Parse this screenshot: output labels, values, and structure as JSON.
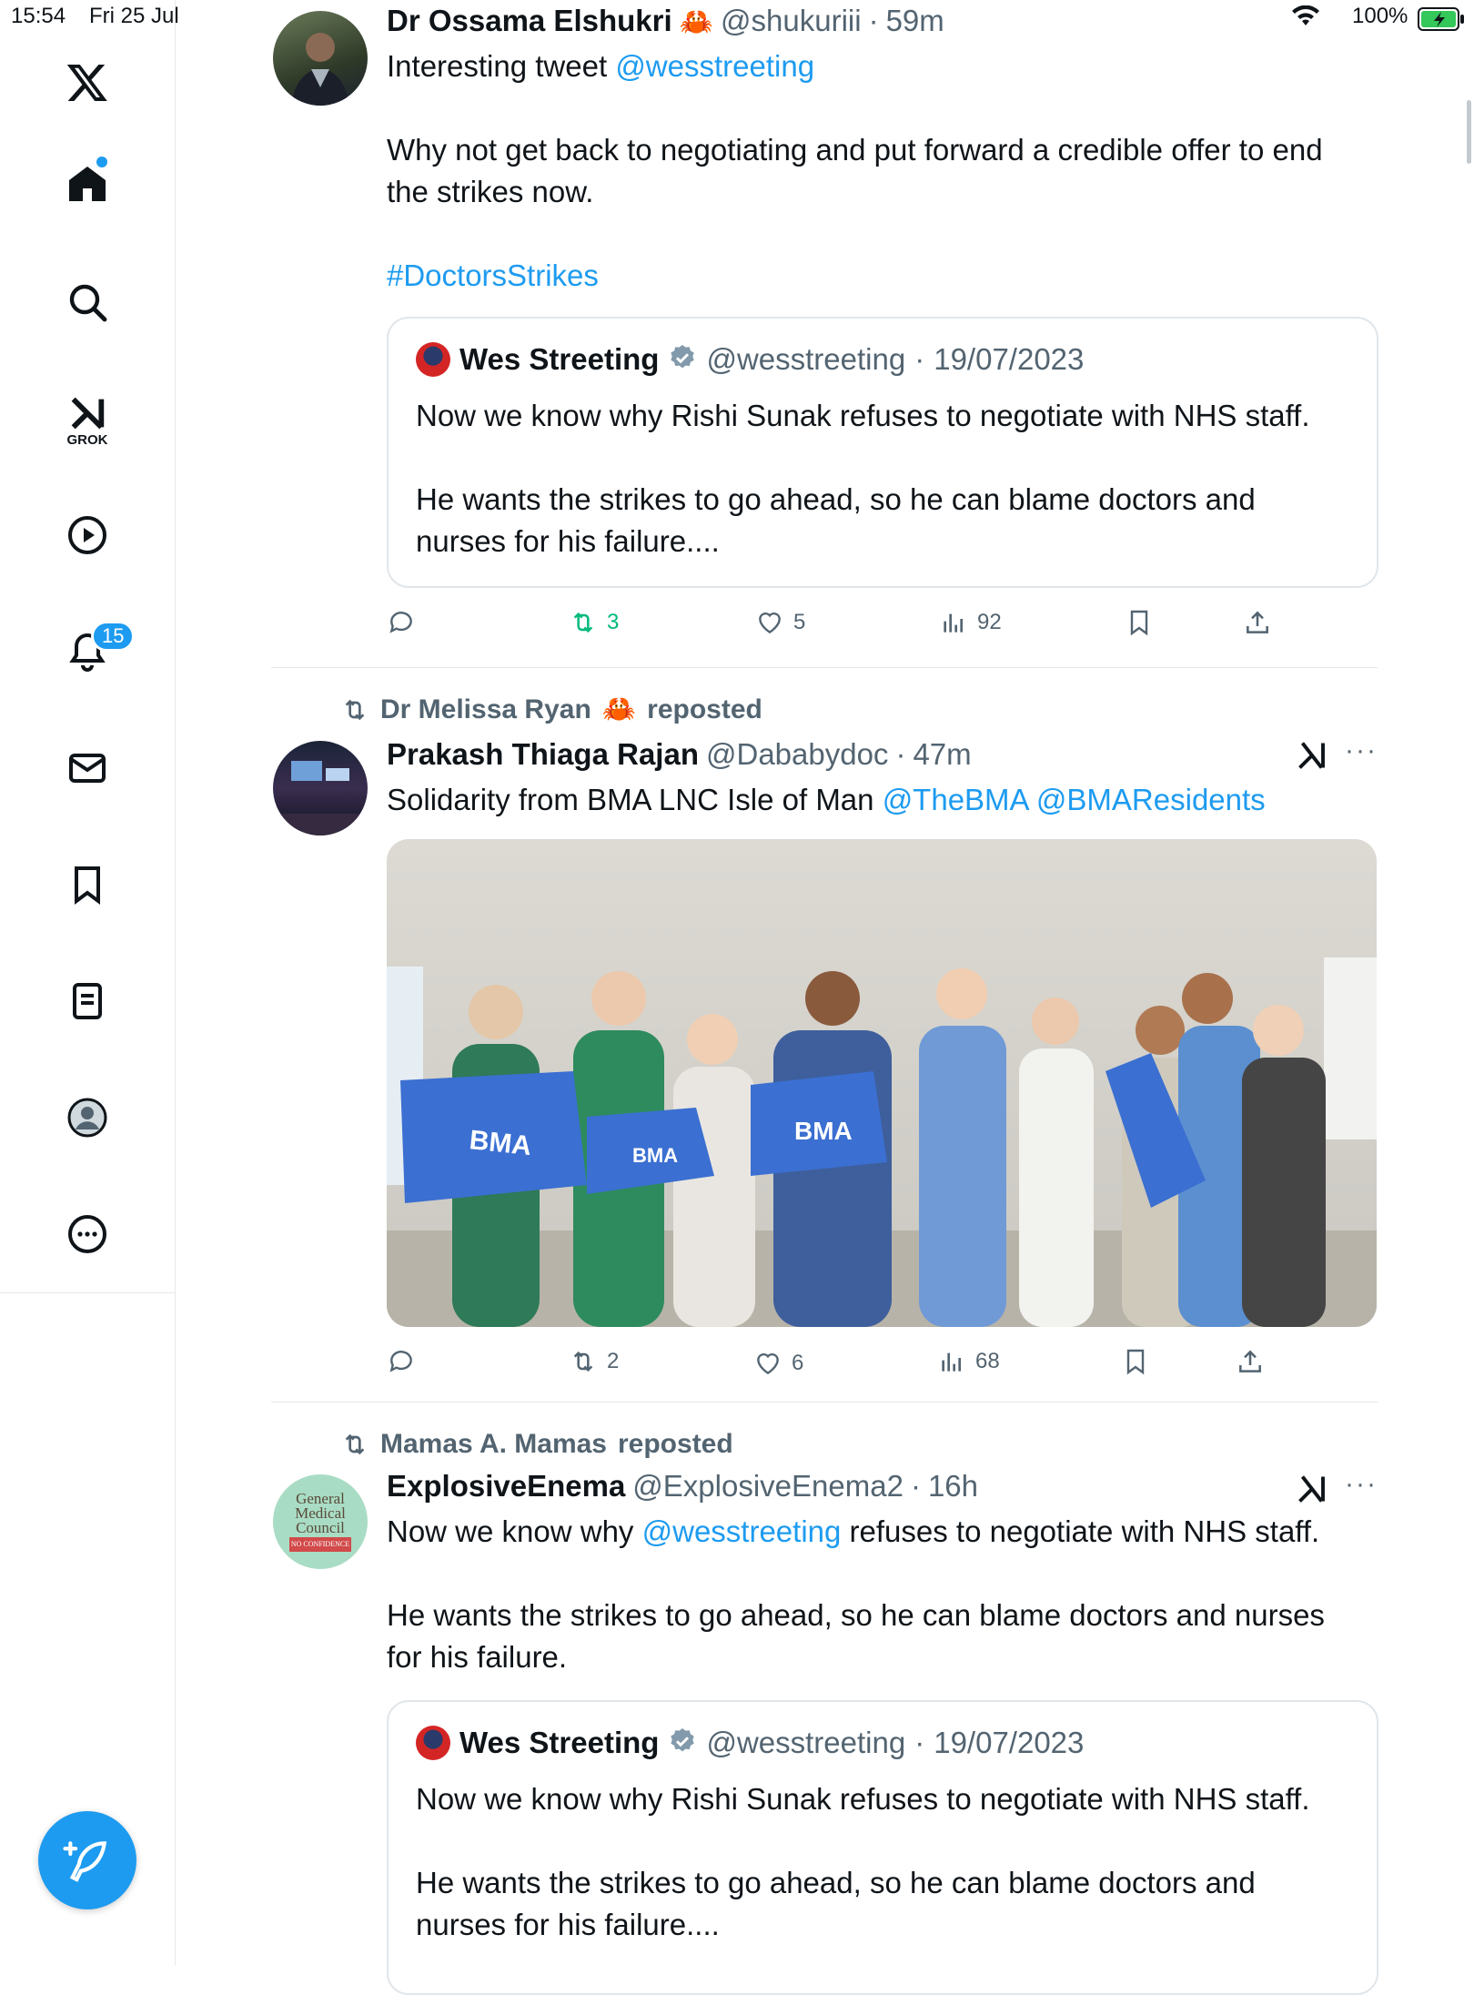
{
  "status_bar": {
    "time": "15:54",
    "date": "Fri 25 Jul",
    "battery": "100%"
  },
  "sidebar": {
    "items": [
      {
        "name": "x-logo-icon"
      },
      {
        "name": "home-icon"
      },
      {
        "name": "search-icon"
      },
      {
        "name": "grok-icon",
        "label": "GROK"
      },
      {
        "name": "video-icon"
      },
      {
        "name": "notifications-icon",
        "badge": "15"
      },
      {
        "name": "messages-icon"
      },
      {
        "name": "bookmarks-icon"
      },
      {
        "name": "lists-icon"
      },
      {
        "name": "profile-icon"
      },
      {
        "name": "more-icon"
      }
    ]
  },
  "tweets": [
    {
      "author": "Dr Ossama Elshukri",
      "emoji": "🦀",
      "handle": "@shukuriii",
      "time": "59m",
      "text_lines": {
        "l1_prefix": "Interesting tweet ",
        "l1_link": "@wesstreeting",
        "l2": "Why not get back to negotiating and put forward a credible offer to end",
        "l3": "the strikes now.",
        "hashtag": "#DoctorsStrikes"
      },
      "quote": {
        "author": "Wes Streeting",
        "handle": "@wesstreeting",
        "date": "19/07/2023",
        "l1": "Now we know why Rishi Sunak refuses to negotiate with NHS staff.",
        "l2": "He wants the strikes to go ahead, so he can blame doctors and",
        "l3": "nurses for his failure...."
      },
      "stats": {
        "replies": "",
        "reposts": "3",
        "likes": "5",
        "views": "92"
      }
    },
    {
      "reposted_by": "Dr Melissa Ryan",
      "reposted_emoji": "🦀",
      "reposted_label": "reposted",
      "author": "Prakash Thiaga Rajan",
      "handle": "@Dababydoc",
      "time": "47m",
      "text_prefix": "Solidarity from BMA LNC Isle of Man ",
      "link1": "@TheBMA",
      "link2": "@BMAResidents",
      "photo_text": "BMA",
      "stats": {
        "replies": "",
        "reposts": "2",
        "likes": "6",
        "views": "68"
      }
    },
    {
      "reposted_by": "Mamas A. Mamas",
      "reposted_label": "reposted",
      "author": "ExplosiveEnema",
      "handle": "@ExplosiveEnema2",
      "time": "16h",
      "avatar_text": {
        "l1": "General",
        "l2": "Medical",
        "l3": "Council",
        "l4": "NO CONFIDENCE"
      },
      "l1_prefix": "Now we know why ",
      "l1_link": "@wesstreeting",
      "l1_suffix": " refuses to negotiate with NHS staff.",
      "l2": "He wants the strikes to go ahead, so he can blame doctors and nurses",
      "l3": "for his failure.",
      "quote": {
        "author": "Wes Streeting",
        "handle": "@wesstreeting",
        "date": "19/07/2023",
        "l1": "Now we know why Rishi Sunak refuses to negotiate with NHS staff.",
        "l2": "He wants the strikes to go ahead, so he can blame doctors and",
        "l3": "nurses for his failure...."
      }
    }
  ],
  "sep": " · ",
  "colors": {
    "accent": "#1d9bf0",
    "repost_green": "#00ba7c",
    "muted": "#536471"
  }
}
